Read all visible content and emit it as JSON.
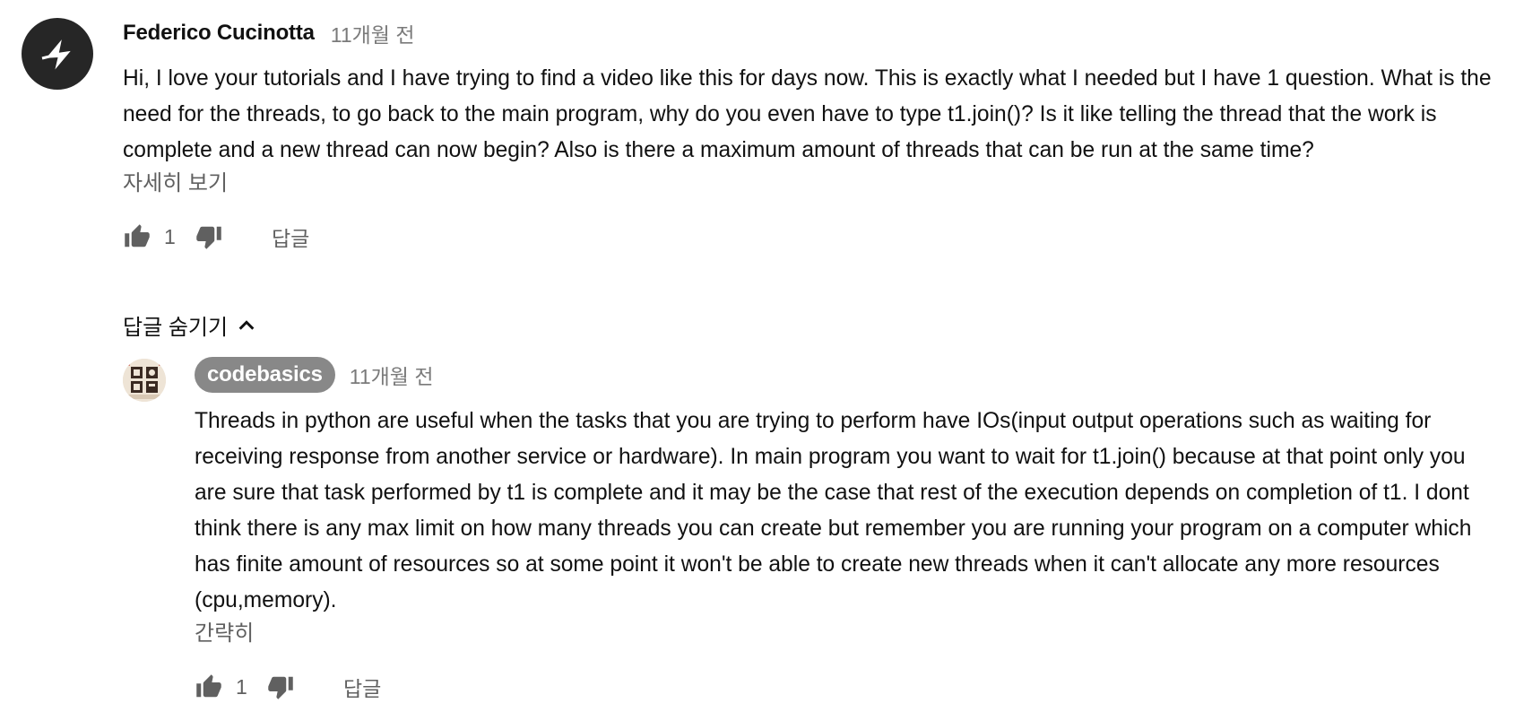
{
  "comment": {
    "author": "Federico Cucinotta",
    "time": "11개월 전",
    "text": "Hi, I love your tutorials and I have trying to find a video like this for days now. This is exactly what I needed but I have 1 question. What is the need for the threads, to go back to the main program, why do you even have to type t1.join()? Is it like telling the thread that the work is complete and a new thread can now begin? Also is there a maximum amount of threads that can be run at the same time?",
    "read_more": "자세히 보기",
    "likes": "1",
    "reply_label": "답글",
    "avatar_icon": "star-logo-icon"
  },
  "replies_toggle": {
    "label": "답글 숨기기"
  },
  "reply": {
    "author": "codebasics",
    "time": "11개월 전",
    "text": "Threads in python are useful when the tasks that you are trying to perform have IOs(input output operations such as waiting for receiving response from another service or hardware). In main program you want to wait for t1.join() because at that point only you are sure that task performed by t1 is complete and it may be the case that rest of the execution depends on completion of t1. I dont think there is any max limit on how many threads you can create but remember you are running your program on a computer which has finite amount of resources so at some point it won't be able to create new threads when it can't allocate any more resources (cpu,memory).",
    "show_less": "간략히",
    "likes": "1",
    "reply_label": "답글",
    "badge_color": "#888888"
  },
  "colors": {
    "text": "#111111",
    "secondary": "#606060",
    "avatar_dark": "#262626"
  }
}
